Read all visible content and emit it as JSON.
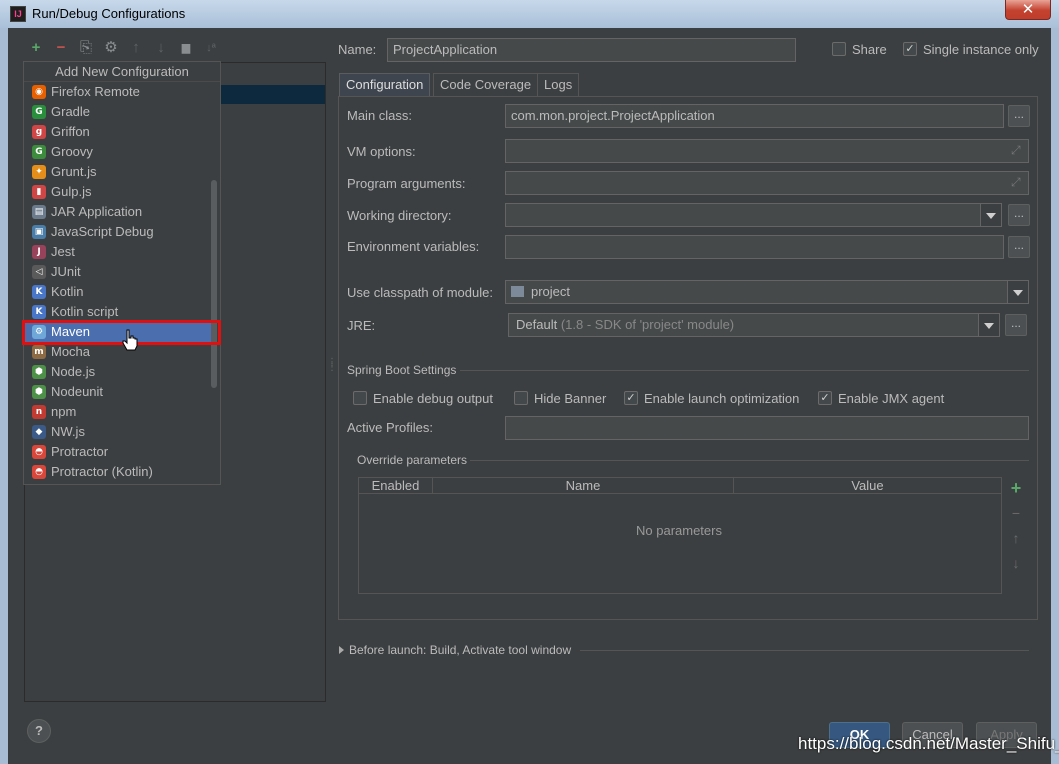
{
  "window": {
    "title": "Run/Debug Configurations",
    "app_icon": "IJ",
    "close_glyph": "✕"
  },
  "toolbar": {
    "add_icon": "+",
    "remove_icon": "−",
    "copy_icon": "⎘",
    "settings_icon": "⚙",
    "up_icon": "↑",
    "down_icon": "↓",
    "folder_icon": "▆",
    "sort_icon": "↓ª"
  },
  "popup": {
    "header": "Add New Configuration",
    "items": [
      {
        "label": "Firefox Remote",
        "icon": "firefox-icon",
        "color": "#e66000",
        "glyph": "◉"
      },
      {
        "label": "Gradle",
        "icon": "gradle-icon",
        "color": "#2a8f3d",
        "glyph": "G"
      },
      {
        "label": "Griffon",
        "icon": "griffon-icon",
        "color": "#d04545",
        "glyph": "g"
      },
      {
        "label": "Groovy",
        "icon": "groovy-icon",
        "color": "#3d8c3d",
        "glyph": "G"
      },
      {
        "label": "Grunt.js",
        "icon": "grunt-icon",
        "color": "#e58f1a",
        "glyph": "✦"
      },
      {
        "label": "Gulp.js",
        "icon": "gulp-icon",
        "color": "#cf4646",
        "glyph": "▮"
      },
      {
        "label": "JAR Application",
        "icon": "jar-icon",
        "color": "#6b7b8c",
        "glyph": "▤"
      },
      {
        "label": "JavaScript Debug",
        "icon": "javascript-debug-icon",
        "color": "#4a7ea8",
        "glyph": "▣"
      },
      {
        "label": "Jest",
        "icon": "jest-icon",
        "color": "#99425b",
        "glyph": "J"
      },
      {
        "label": "JUnit",
        "icon": "junit-icon",
        "color": "#5a5a5a",
        "glyph": "◁"
      },
      {
        "label": "Kotlin",
        "icon": "kotlin-icon",
        "color": "#4a76c8",
        "glyph": "K"
      },
      {
        "label": "Kotlin script",
        "icon": "kotlin-script-icon",
        "color": "#4a76c8",
        "glyph": "K"
      },
      {
        "label": "Maven",
        "icon": "maven-gear-icon",
        "color": "#6fa7d8",
        "glyph": "⚙"
      },
      {
        "label": "Mocha",
        "icon": "mocha-icon",
        "color": "#8c6b44",
        "glyph": "m"
      },
      {
        "label": "Node.js",
        "icon": "nodejs-icon",
        "color": "#4d9148",
        "glyph": "⬢"
      },
      {
        "label": "Nodeunit",
        "icon": "nodeunit-icon",
        "color": "#4d9148",
        "glyph": "⬢"
      },
      {
        "label": "npm",
        "icon": "npm-icon",
        "color": "#c23b32",
        "glyph": "n"
      },
      {
        "label": "NW.js",
        "icon": "nwjs-icon",
        "color": "#3b5a88",
        "glyph": "◆"
      },
      {
        "label": "Protractor",
        "icon": "protractor-icon",
        "color": "#d9473b",
        "glyph": "◓"
      },
      {
        "label": "Protractor (Kotlin)",
        "icon": "protractor-kotlin-icon",
        "color": "#d9473b",
        "glyph": "◓"
      }
    ],
    "selected_index": 12
  },
  "header": {
    "name_label": "Name:",
    "name_value": "ProjectApplication",
    "share_label": "Share",
    "share_checked": false,
    "single_instance_label": "Single instance only",
    "single_instance_checked": true
  },
  "tabs": [
    {
      "label": "Configuration",
      "active": true
    },
    {
      "label": "Code Coverage",
      "active": false
    },
    {
      "label": "Logs",
      "active": false
    }
  ],
  "form": {
    "main_class_label": "Main class:",
    "main_class_value": "com.mon.project.ProjectApplication",
    "vm_options_label": "VM options:",
    "vm_options_value": "",
    "program_args_label": "Program arguments:",
    "program_args_value": "",
    "working_dir_label": "Working directory:",
    "working_dir_value": "",
    "env_vars_label": "Environment variables:",
    "env_vars_value": "",
    "classpath_label": "Use classpath of module:",
    "classpath_value": "project",
    "jre_label": "JRE:",
    "jre_value": "Default",
    "jre_hint": "(1.8 - SDK of 'project' module)",
    "dots": "...",
    "expand_glyph": "⤢"
  },
  "spring_boot": {
    "section_title": "Spring Boot Settings",
    "options": [
      {
        "label": "Enable debug output",
        "checked": false
      },
      {
        "label": "Hide Banner",
        "checked": false
      },
      {
        "label": "Enable launch optimization",
        "checked": true
      },
      {
        "label": "Enable JMX agent",
        "checked": true
      }
    ],
    "active_profiles_label": "Active Profiles:",
    "active_profiles_value": ""
  },
  "override": {
    "section_title": "Override parameters",
    "columns": [
      "Enabled",
      "Name",
      "Value"
    ],
    "empty_text": "No parameters",
    "add_icon": "+",
    "remove_icon": "−",
    "up_icon": "↑",
    "down_icon": "↓"
  },
  "before_launch": {
    "label": "Before launch: Build, Activate tool window"
  },
  "footer": {
    "help": "?",
    "ok": "OK",
    "cancel": "Cancel",
    "apply": "Apply",
    "watermark": "https://blog.csdn.net/Master_Shifu_"
  },
  "colors": {
    "accent_selected": "#4b6eaf",
    "highlight_border": "#e01010",
    "dialog_bg": "#3c3f41"
  }
}
